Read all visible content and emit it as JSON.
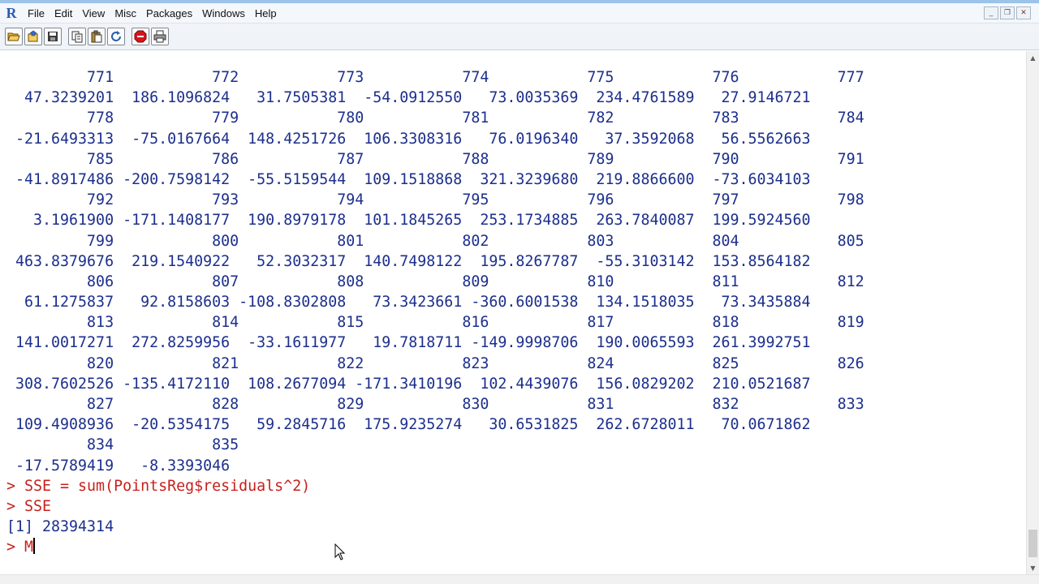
{
  "app": {
    "logo_text": "R",
    "accent": "#2a5db0"
  },
  "menu": [
    "File",
    "Edit",
    "View",
    "Misc",
    "Packages",
    "Windows",
    "Help"
  ],
  "window_controls": [
    {
      "name": "minimize-button",
      "glyph": "_"
    },
    {
      "name": "restore-button",
      "glyph": "❐"
    },
    {
      "name": "close-button",
      "glyph": "✕"
    }
  ],
  "toolbar": [
    {
      "name": "open-script-button",
      "icon": "open-folder-icon"
    },
    {
      "name": "load-workspace-button",
      "icon": "load-workspace-icon"
    },
    {
      "name": "save-workspace-button",
      "icon": "save-icon"
    },
    {
      "name": "copy-button",
      "icon": "copy-icon"
    },
    {
      "name": "paste-button",
      "icon": "paste-icon"
    },
    {
      "name": "copy-paste-button",
      "icon": "refresh-icon"
    },
    {
      "name": "stop-button",
      "icon": "stop-icon"
    },
    {
      "name": "print-button",
      "icon": "print-icon"
    }
  ],
  "console": {
    "output_rows": [
      "         771           772           773           774           775           776           777",
      "  47.3239201  186.1096824   31.7505381  -54.0912550   73.0035369  234.4761589   27.9146721",
      "         778           779           780           781           782           783           784",
      " -21.6493313  -75.0167664  148.4251726  106.3308316   76.0196340   37.3592068   56.5562663",
      "         785           786           787           788           789           790           791",
      " -41.8917486 -200.7598142  -55.5159544  109.1518868  321.3239680  219.8866600  -73.6034103",
      "         792           793           794           795           796           797           798",
      "   3.1961900 -171.1408177  190.8979178  101.1845265  253.1734885  263.7840087  199.5924560",
      "         799           800           801           802           803           804           805",
      " 463.8379676  219.1540922   52.3032317  140.7498122  195.8267787  -55.3103142  153.8564182",
      "         806           807           808           809           810           811           812",
      "  61.1275837   92.8158603 -108.8302808   73.3423661 -360.6001538  134.1518035   73.3435884",
      "         813           814           815           816           817           818           819",
      " 141.0017271  272.8259956  -33.1611977   19.7818711 -149.9998706  190.0065593  261.3992751",
      "         820           821           822           823           824           825           826",
      " 308.7602526 -135.4172110  108.2677094 -171.3410196  102.4439076  156.0829202  210.0521687",
      "         827           828           829           830           831           832           833",
      " 109.4908936  -20.5354175   59.2845716  175.9235274   30.6531825  262.6728011   70.0671862",
      "         834           835",
      " -17.5789419   -8.3393046"
    ],
    "cmd1": "> SSE = sum(PointsReg$residuals^2)",
    "cmd2": "> SSE",
    "result": "[1] 28394314",
    "prompt": "> ",
    "input_value": "M",
    "output_color": "#1c2f8c",
    "command_color": "#c6201c"
  }
}
